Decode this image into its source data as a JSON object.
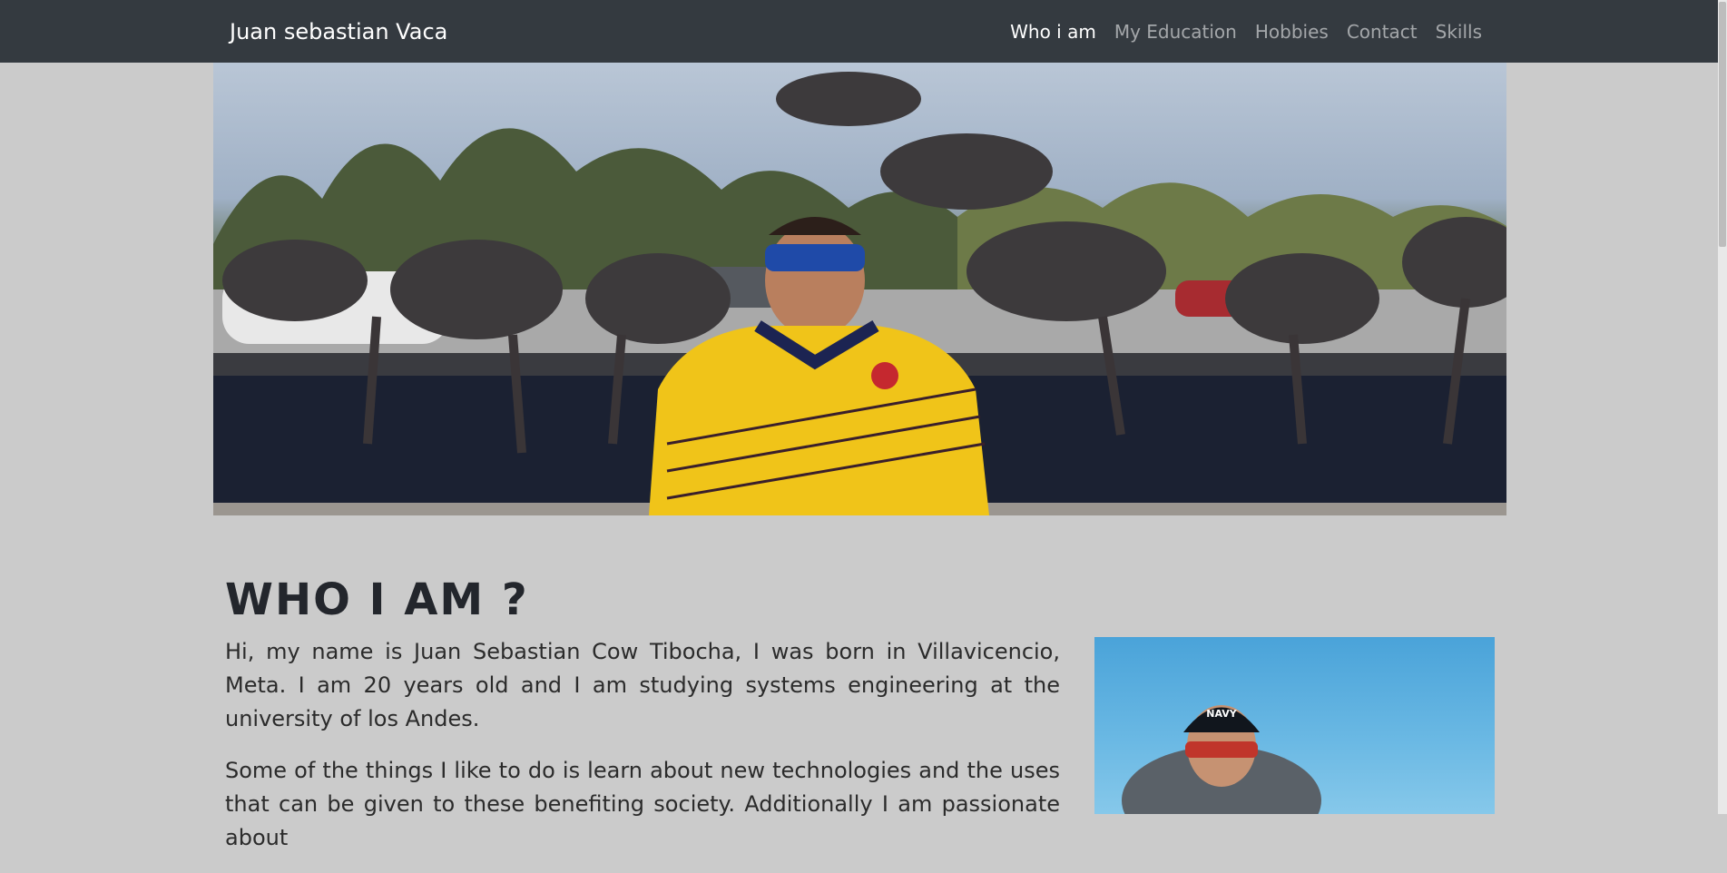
{
  "navbar": {
    "brand": "Juan sebastian Vaca",
    "items": [
      {
        "label": "Who i am",
        "active": true
      },
      {
        "label": "My Education",
        "active": false
      },
      {
        "label": "Hobbies",
        "active": false
      },
      {
        "label": "Contact",
        "active": false
      },
      {
        "label": "Skills",
        "active": false
      }
    ]
  },
  "about": {
    "title": "WHO I AM ?",
    "paragraphs": [
      "Hi, my name is Juan Sebastian Cow Tibocha, I was born in Villavicencio, Meta. I am 20 years old and I am studying systems engineering at the university of los Andes.",
      "Some of the things I like to do is learn about new technologies and the uses that can be given to these benefiting society. Additionally I am passionate about"
    ],
    "cap_text": "NAVY"
  },
  "colors": {
    "navbar_bg": "#343a40",
    "page_bg": "#cbcbcb",
    "jersey": "#f0c419"
  }
}
